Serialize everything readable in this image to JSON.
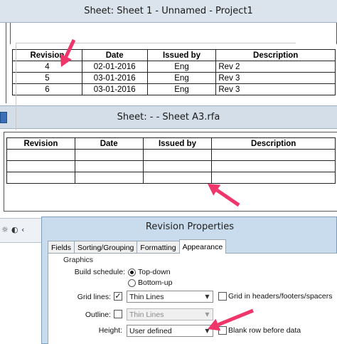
{
  "window1": {
    "title": "Sheet: Sheet 1 - Unnamed - Project1"
  },
  "window2": {
    "title": "Sheet:  -  - Sheet A3.rfa"
  },
  "schedule1": {
    "headers": [
      "Revision",
      "Date",
      "Issued by",
      "Description"
    ],
    "rows": [
      [
        "4",
        "02-01-2016",
        "Eng",
        "Rev 2"
      ],
      [
        "5",
        "03-01-2016",
        "Eng",
        "Rev 3"
      ],
      [
        "6",
        "03-01-2016",
        "Eng",
        "Rev 3"
      ]
    ]
  },
  "schedule2": {
    "headers": [
      "Revision",
      "Date",
      "Issued by",
      "Description"
    ],
    "rows": [
      [
        "",
        "",
        "",
        ""
      ],
      [
        "",
        "",
        "",
        ""
      ],
      [
        "",
        "",
        "",
        ""
      ]
    ]
  },
  "dialog": {
    "title": "Revision Properties",
    "tabs": [
      "Fields",
      "Sorting/Grouping",
      "Formatting",
      "Appearance"
    ],
    "active_tab": "Appearance",
    "graphics_group": "Graphics",
    "build_schedule_label": "Build schedule:",
    "build_options": [
      "Top-down",
      "Bottom-up"
    ],
    "build_selected": "Top-down",
    "grid_lines_label": "Grid lines:",
    "grid_lines_checked": "✓",
    "grid_lines_value": "Thin Lines",
    "grid_in_headers_label": "Grid in headers/footers/spacers",
    "outline_label": "Outline:",
    "outline_value": "Thin Lines",
    "height_label": "Height:",
    "height_value": "User defined",
    "blank_row_label": "Blank row before data"
  },
  "annotation_color": "#f0356b"
}
